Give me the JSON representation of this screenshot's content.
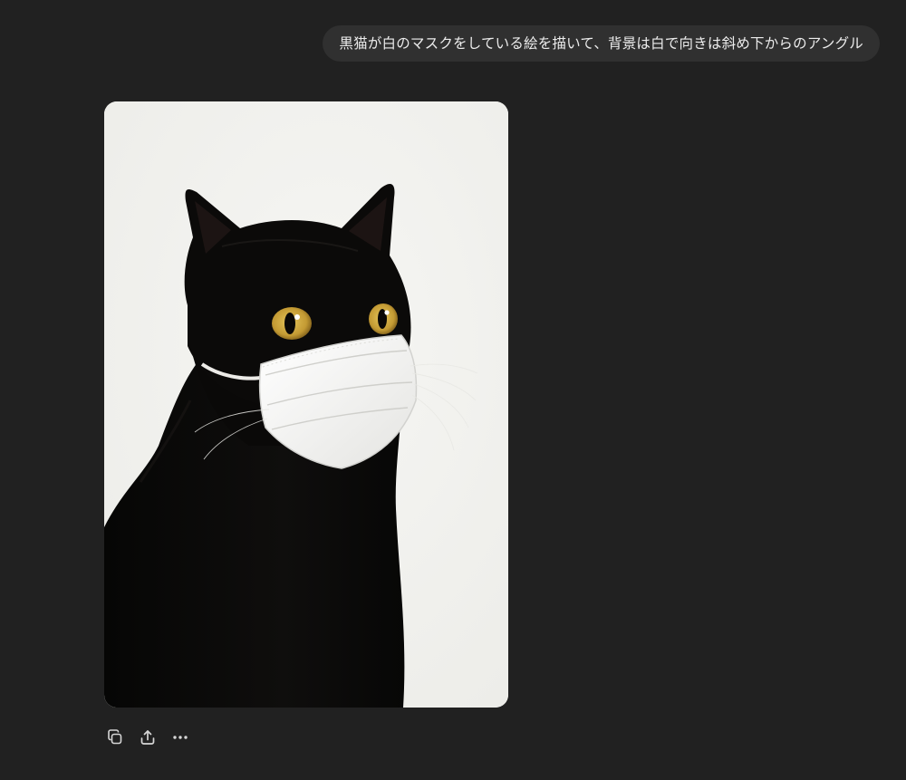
{
  "conversation": {
    "user_message": "黒猫が白のマスクをしている絵を描いて、背景は白で向きは斜め下からのアングル"
  },
  "generated_image": {
    "background_color": "#f2f2ef",
    "subject_color": "#0b0a09",
    "mask_color": "#f7f7f5",
    "eye_color": "#c9a23c"
  },
  "actions": [
    {
      "name": "copy",
      "icon": "copy-icon"
    },
    {
      "name": "share",
      "icon": "share-icon"
    },
    {
      "name": "more",
      "icon": "more-icon"
    }
  ],
  "theme": {
    "page_background": "#212121",
    "bubble_background": "#303030",
    "text_color": "#ececec",
    "icon_color": "#d6d6d6"
  }
}
